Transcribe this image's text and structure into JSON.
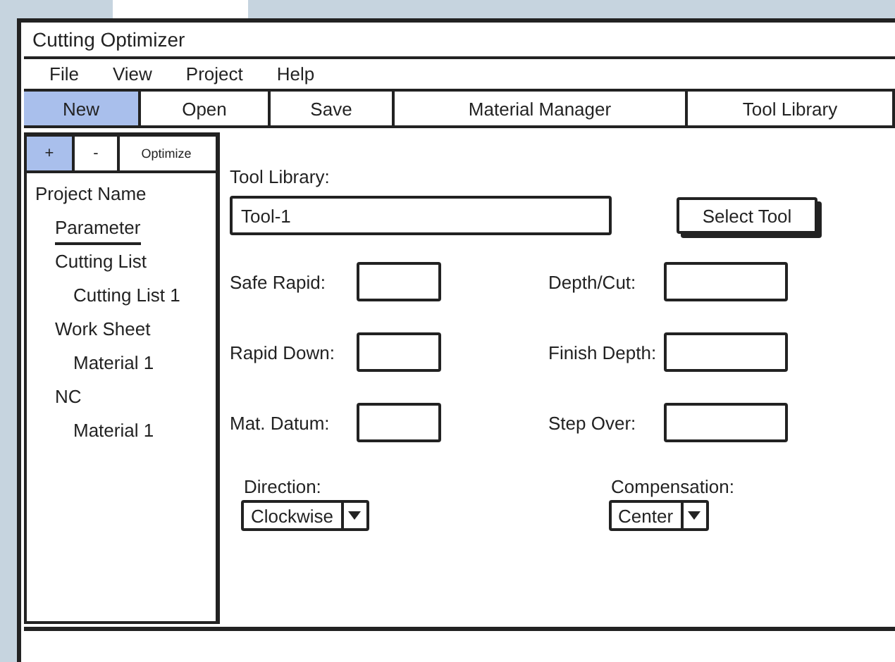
{
  "window": {
    "title": "Cutting Optimizer"
  },
  "menu": [
    {
      "label": "File"
    },
    {
      "label": "View"
    },
    {
      "label": "Project"
    },
    {
      "label": "Help"
    }
  ],
  "toolbar": [
    {
      "label": "New",
      "selected": true
    },
    {
      "label": "Open",
      "selected": false
    },
    {
      "label": "Save",
      "selected": false
    },
    {
      "label": "Material Manager",
      "selected": false
    },
    {
      "label": "Tool Library",
      "selected": false
    }
  ],
  "panel_toolbar": [
    {
      "label": "+",
      "selected": true
    },
    {
      "label": "-",
      "selected": false
    },
    {
      "label": "Optimize",
      "selected": false
    }
  ],
  "tree": [
    {
      "label": "Project Name",
      "selected": false,
      "children": [
        {
          "label": "Parameter",
          "selected": true
        },
        {
          "label": "Cutting List",
          "selected": false,
          "children": [
            {
              "label": "Cutting List 1",
              "selected": false
            }
          ]
        },
        {
          "label": "Work Sheet",
          "selected": false,
          "children": [
            {
              "label": "Material 1",
              "selected": false
            }
          ]
        },
        {
          "label": "NC",
          "selected": false,
          "children": [
            {
              "label": "Material 1",
              "selected": false
            }
          ]
        }
      ]
    }
  ],
  "form": {
    "tool_library": {
      "label": "Tool Library:",
      "value": "Tool-1"
    },
    "select_button": "Select Tool",
    "fields": [
      {
        "label": "Safe Rapid:"
      },
      {
        "label": "Depth/Cut:"
      },
      {
        "label": "Rapid Down:"
      },
      {
        "label": "Finish Depth:"
      },
      {
        "label": "Mat. Datum:"
      },
      {
        "label": "Step Over:"
      }
    ],
    "dropdowns": [
      {
        "label": "Direction:",
        "value": "Clockwise"
      },
      {
        "label": "Compensation:",
        "value": "Center"
      }
    ]
  }
}
